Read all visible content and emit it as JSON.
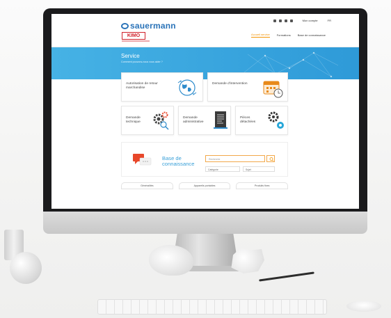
{
  "header": {
    "brand": "sauermann",
    "sub_brand": "KIMO",
    "account_link": "Mon compte",
    "lang": "FR",
    "nav": [
      "Accueil service",
      "Formations",
      "Base de connaissance"
    ]
  },
  "hero": {
    "title": "Service",
    "subtitle": "Comment pouvons-nous vous aider ?"
  },
  "cards": [
    {
      "label": "Autorisation de retour marchandise"
    },
    {
      "label": "Demande d'intervention"
    },
    {
      "label": "Demande technique"
    },
    {
      "label": "Demande administrative"
    },
    {
      "label": "Pièces détachées"
    }
  ],
  "knowledge_base": {
    "title": "Base de connaissance",
    "search_placeholder": "Recherche",
    "select_category": "Catégorie",
    "select_type": "Sujet",
    "tabs": [
      "Généralités",
      "Appareils portables",
      "Produits fixes"
    ]
  },
  "colors": {
    "brand_blue": "#2a73b8",
    "hero_blue": "#46b2e5",
    "accent_orange": "#f39200",
    "kimo_red": "#d0202a"
  }
}
